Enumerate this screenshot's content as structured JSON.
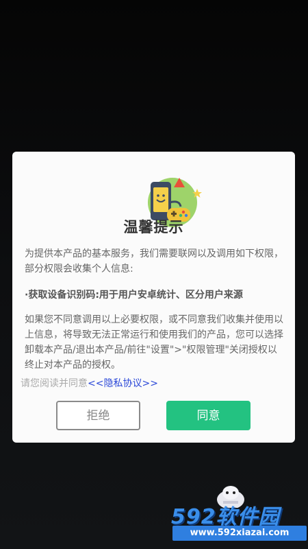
{
  "dialog": {
    "title": "温馨提示",
    "paragraph_1": "为提供本产品的基本服务，我们需要联网以及调用如下权限，部分权限会收集个人信息:",
    "paragraph_2": "·获取设备识别码:用于用户安卓统计、区分用户来源",
    "paragraph_3": "如果您不同意调用以上必要权限，或不同意我们收集并使用以上信息，将导致无法正常运行和使用我们的产品，您可以选择卸载本产品/退出本产品/前往\"设置\">\"权限管理\"关闭授权以终止对本产品的授权。",
    "privacy_prefix": "请您阅读并同意",
    "privacy_link": "<<隐私协议>>",
    "reject_label": "拒绝",
    "agree_label": "同意"
  },
  "watermark": {
    "brand": "592软件园",
    "url": "www.592xiazai.com"
  },
  "colors": {
    "agree_button": "#23c281",
    "privacy_link": "#2b48d8",
    "watermark_blue": "#3a8eea"
  },
  "icons": [
    "phone-gamepad-illustration",
    "warning-triangle-icon",
    "star-icon"
  ]
}
